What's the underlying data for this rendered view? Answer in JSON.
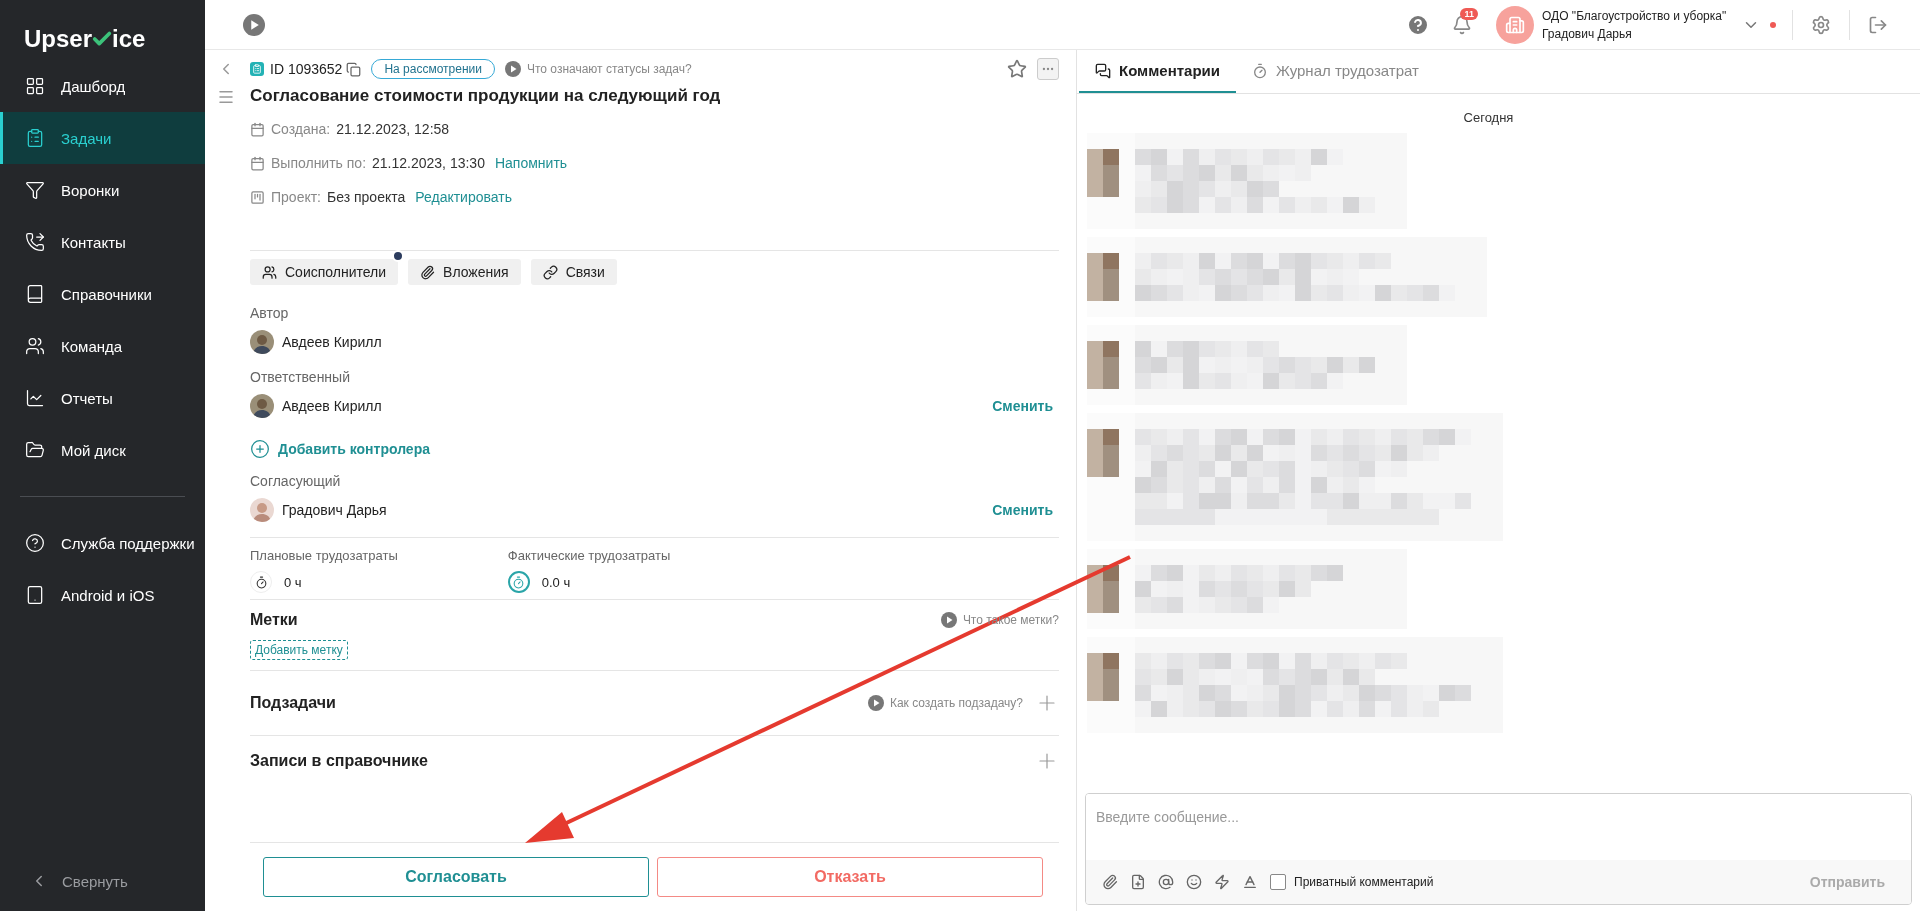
{
  "sidebar": {
    "logo": {
      "before": "Upser",
      "after": "ice"
    },
    "items": [
      {
        "label": "Дашборд",
        "selected": false
      },
      {
        "label": "Задачи",
        "selected": true
      },
      {
        "label": "Воронки",
        "selected": false
      },
      {
        "label": "Контакты",
        "selected": false
      },
      {
        "label": "Справочники",
        "selected": false
      },
      {
        "label": "Команда",
        "selected": false
      },
      {
        "label": "Отчеты",
        "selected": false
      },
      {
        "label": "Мой диск",
        "selected": false
      }
    ],
    "extra_items": [
      {
        "label": "Служба поддержки",
        "selected": false
      },
      {
        "label": "Android и iOS",
        "selected": false
      }
    ],
    "collapse": "Свернуть"
  },
  "topbar": {
    "notifications": "11",
    "company": "ОДО \"Благоустройство и уборка\"",
    "user": "Градович Дарья"
  },
  "task": {
    "id": "ID 1093652",
    "status": "На рассмотрении",
    "status_help": "Что означают статусы задач?",
    "starred": false,
    "title": "Согласование стоимости продукции на следующий год",
    "meta": [
      {
        "kind": "date",
        "label": "Создана:",
        "value": "21.12.2023, 12:58"
      },
      {
        "kind": "date",
        "label": "Выполнить по:",
        "value": "21.12.2023, 13:30",
        "link": "Напомнить"
      },
      {
        "kind": "project",
        "label": "Проект:",
        "value": "Без проекта",
        "link": "Редактировать"
      }
    ],
    "tabs": [
      {
        "label": "Соисполнители",
        "dot": true
      },
      {
        "label": "Вложения",
        "dot": false
      },
      {
        "label": "Связи",
        "dot": false
      }
    ],
    "participants": [
      {
        "kind": "person",
        "role": "Автор",
        "name": "Авдеев Кирилл"
      },
      {
        "kind": "person",
        "role": "Ответственный",
        "name": "Авдеев Кирилл",
        "action": "Сменить"
      },
      {
        "kind": "add",
        "label": "Добавить контролера"
      },
      {
        "kind": "person",
        "role": "Согласующий",
        "name": "Градович Дарья",
        "action": "Сменить"
      }
    ],
    "effort": [
      {
        "label": "Плановые трудозатраты",
        "value": "0 ч",
        "active": false
      },
      {
        "label": "Фактические трудозатраты",
        "value": "0.0 ч",
        "active": true
      }
    ],
    "tags": {
      "title": "Метки",
      "help": "Что такое метки?",
      "add": "Добавить метку"
    },
    "sections": [
      {
        "title": "Подзадачи",
        "help": "Как создать подзадачу?"
      },
      {
        "title": "Записи в справочнике"
      }
    ],
    "actions": [
      {
        "kind": "approve",
        "label": "Согласовать"
      },
      {
        "kind": "reject",
        "label": "Отказать"
      }
    ]
  },
  "comments_panel": {
    "tabs": [
      {
        "label": "Комментарии",
        "selected": true
      },
      {
        "label": "Журнал трудозатрат",
        "selected": false
      }
    ],
    "date": "Сегодня",
    "composer": {
      "placeholder": "Введите сообщение...",
      "private_label": "Приватный комментарий",
      "private_checked": false,
      "send": "Отправить"
    }
  },
  "annotation": {
    "kind": "arrow"
  }
}
